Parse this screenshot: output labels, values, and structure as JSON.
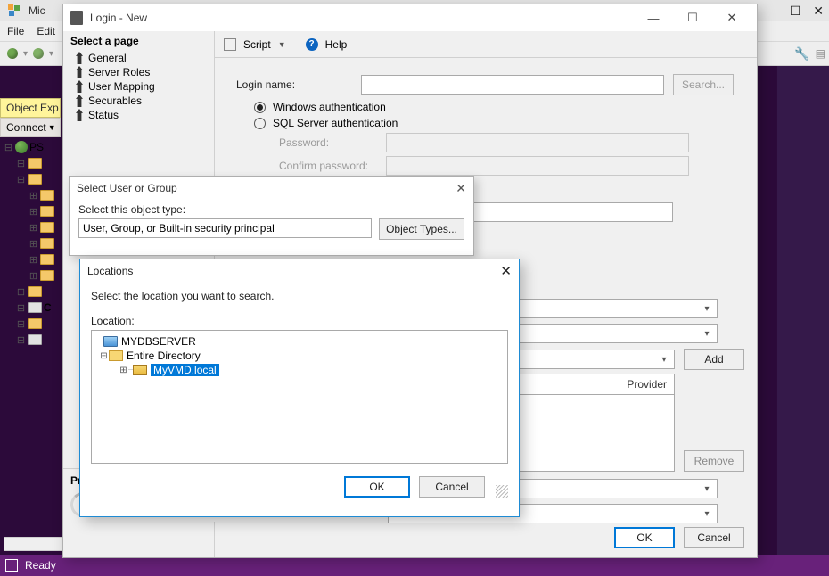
{
  "ssms": {
    "title_prefix": "Mic",
    "menu": {
      "file": "File",
      "edit": "Edit"
    },
    "obj_explorer": "Object Exp",
    "connect": "Connect",
    "root_node": "PS",
    "ready": "Ready"
  },
  "login_dialog": {
    "title": "Login - New",
    "select_page": "Select a page",
    "pages": {
      "general": "General",
      "server_roles": "Server Roles",
      "user_mapping": "User Mapping",
      "securables": "Securables",
      "status": "Status"
    },
    "script": "Script",
    "help": "Help",
    "login_name_label": "Login name:",
    "search_btn": "Search...",
    "auth": {
      "windows": "Windows authentication",
      "sql": "SQL Server authentication",
      "password": "Password:",
      "confirm": "Confirm password:"
    },
    "credentials_header": "Provider",
    "add_btn": "Add",
    "remove_btn": "Remove",
    "ok": "OK",
    "cancel": "Cancel",
    "progress_header": "Pr"
  },
  "select_user": {
    "title": "Select User or Group",
    "object_type_label": "Select this object type:",
    "object_type_value": "User, Group, or Built-in security principal",
    "object_types_btn": "Object Types..."
  },
  "locations": {
    "title": "Locations",
    "message": "Select the location you want to search.",
    "label": "Location:",
    "root": "MYDBSERVER",
    "directory": "Entire Directory",
    "domain": "MyVMD.local",
    "ok": "OK",
    "cancel": "Cancel"
  }
}
